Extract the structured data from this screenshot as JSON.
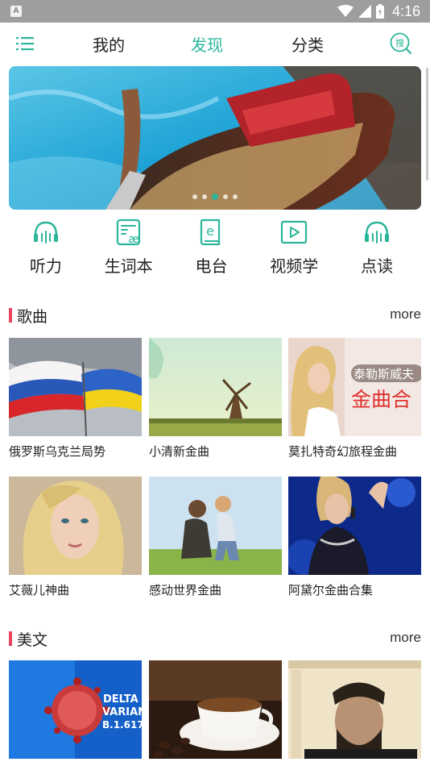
{
  "status_bar": {
    "app_badge": "A",
    "time": "4:16"
  },
  "nav": {
    "tabs": [
      {
        "label": "我的"
      },
      {
        "label": "发现"
      },
      {
        "label": "分类"
      }
    ],
    "active_tab": "发现",
    "search_label": "搜"
  },
  "accent_color": "#2bb59a",
  "section_bar_color": "#e9435f",
  "quick_links": [
    {
      "label": "听力",
      "icon": "headphones-icon"
    },
    {
      "label": "生词本",
      "icon": "vocabulary-book-icon"
    },
    {
      "label": "电台",
      "icon": "radio-book-icon"
    },
    {
      "label": "视频学",
      "icon": "video-play-icon"
    },
    {
      "label": "点读",
      "icon": "headphones-icon"
    }
  ],
  "sections": [
    {
      "title": "歌曲",
      "more": "more",
      "items": [
        {
          "title": "俄罗斯乌克兰局势"
        },
        {
          "title": "小清新金曲"
        },
        {
          "title": "莫扎特奇幻旅程金曲",
          "overlay_line1": "泰勒斯威夫",
          "overlay_line2": "金曲合"
        },
        {
          "title": "艾薇儿神曲"
        },
        {
          "title": "感动世界金曲"
        },
        {
          "title": "阿黛尔金曲合集"
        }
      ]
    },
    {
      "title": "美文",
      "more": "more",
      "items": [
        {
          "overlay_line1": "DELTA",
          "overlay_line2": "VARIANT",
          "overlay_line3": "B.1.617.2"
        },
        {},
        {}
      ]
    }
  ]
}
